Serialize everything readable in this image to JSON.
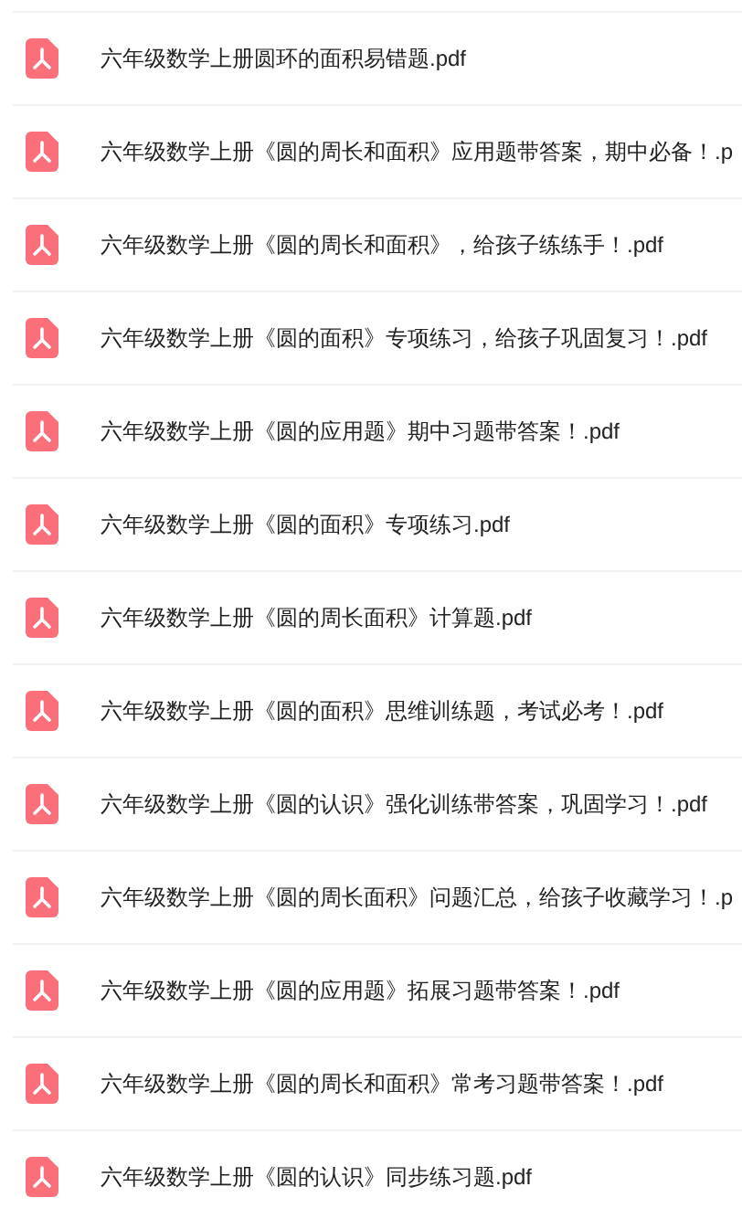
{
  "files": [
    {
      "name": "六年级数学上册圆环的面积易错题.pdf"
    },
    {
      "name": "六年级数学上册《圆的周长和面积》应用题带答案，期中必备！.p"
    },
    {
      "name": "六年级数学上册《圆的周长和面积》，给孩子练练手！.pdf"
    },
    {
      "name": "六年级数学上册《圆的面积》专项练习，给孩子巩固复习！.pdf"
    },
    {
      "name": "六年级数学上册《圆的应用题》期中习题带答案！.pdf"
    },
    {
      "name": "六年级数学上册《圆的面积》专项练习.pdf"
    },
    {
      "name": "六年级数学上册《圆的周长面积》计算题.pdf"
    },
    {
      "name": "六年级数学上册《圆的面积》思维训练题，考试必考！.pdf"
    },
    {
      "name": "六年级数学上册《圆的认识》强化训练带答案，巩固学习！.pdf"
    },
    {
      "name": "六年级数学上册《圆的周长面积》问题汇总，给孩子收藏学习！.p"
    },
    {
      "name": "六年级数学上册《圆的应用题》拓展习题带答案！.pdf"
    },
    {
      "name": "六年级数学上册《圆的周长和面积》常考习题带答案！.pdf"
    },
    {
      "name": "六年级数学上册《圆的认识》同步练习题.pdf"
    }
  ]
}
